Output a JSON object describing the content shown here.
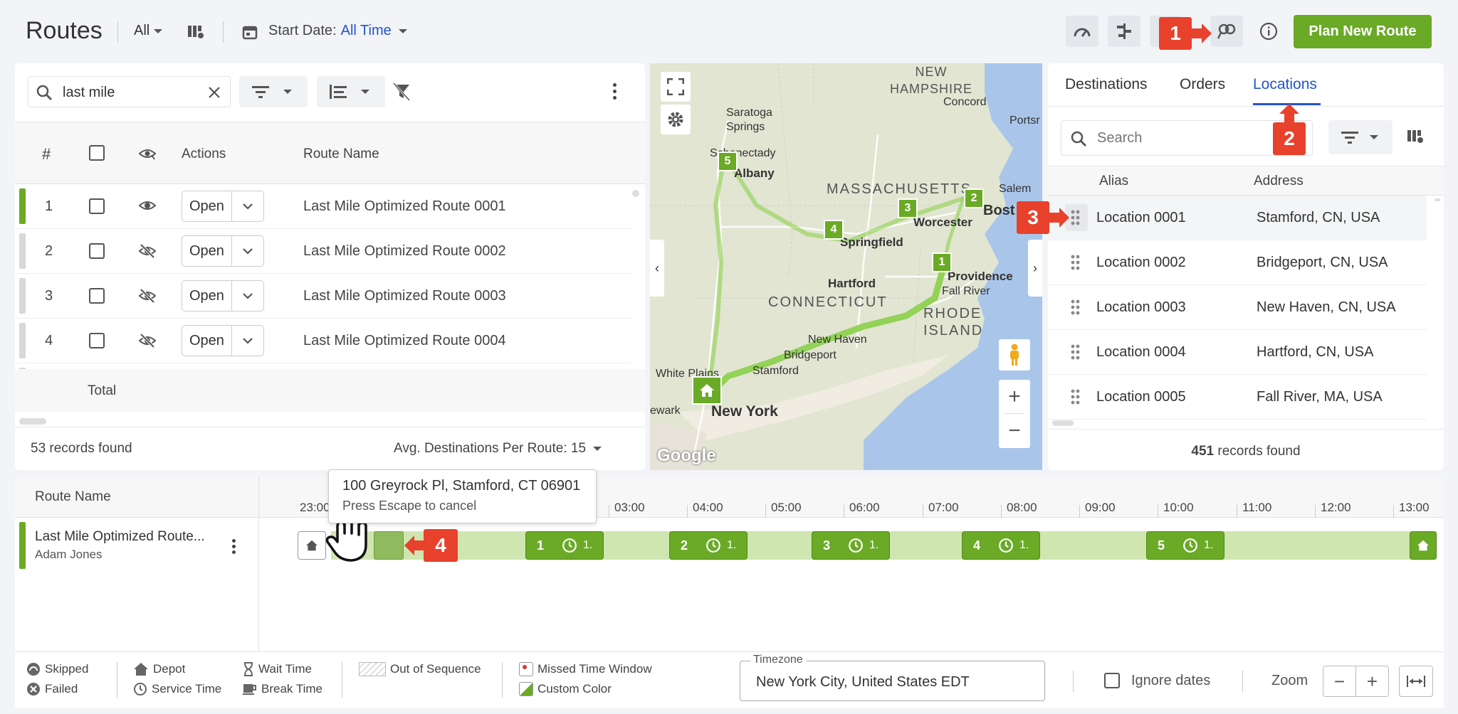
{
  "header": {
    "title": "Routes",
    "filter_all": "All",
    "start_date_label": "Start Date:",
    "start_date_value": "All Time",
    "plan_button": "Plan New Route"
  },
  "routes_panel": {
    "search_value": "last mile",
    "columns": {
      "num": "#",
      "actions": "Actions",
      "route_name": "Route Name"
    },
    "rows": [
      {
        "num": "1",
        "open": "Open",
        "name": "Last Mile Optimized Route 0001",
        "visible": true,
        "bar_color": "#6aaa26"
      },
      {
        "num": "2",
        "open": "Open",
        "name": "Last Mile Optimized Route 0002",
        "visible": false,
        "bar_color": "#d8d8d8"
      },
      {
        "num": "3",
        "open": "Open",
        "name": "Last Mile Optimized Route 0003",
        "visible": false,
        "bar_color": "#d8d8d8"
      },
      {
        "num": "4",
        "open": "Open",
        "name": "Last Mile Optimized Route 0004",
        "visible": false,
        "bar_color": "#d8d8d8"
      }
    ],
    "total_label": "Total",
    "records_found": "53 records found",
    "avg_label": "Avg. Destinations Per Route: 15"
  },
  "map": {
    "labels": {
      "new_hampshire": "NEW HAMPSHIRE",
      "concord": "Concord",
      "saratoga": "Saratoga Springs",
      "schenectady": "Schenectady",
      "albany": "Albany",
      "massachusetts": "MASSACHUSETTS",
      "salem": "Salem",
      "boston": "Bost",
      "worcester": "Worcester",
      "springfield": "Springfield",
      "hartford": "Hartford",
      "providence": "Providence",
      "connecticut": "CONNECTICUT",
      "rhode_island": "RHODE ISLAND",
      "fall_river": "Fall River",
      "new_haven": "New Haven",
      "bridgeport": "Bridgeport",
      "stamford": "Stamford",
      "white_plains": "White Plains",
      "newark": "ewark",
      "new_york": "New York",
      "portsmouth": "Portsr",
      "google": "Google"
    },
    "markers": [
      "1",
      "2",
      "3",
      "4",
      "5"
    ]
  },
  "locations_panel": {
    "tabs": [
      "Destinations",
      "Orders",
      "Locations"
    ],
    "active_tab": "Locations",
    "search_placeholder": "Search",
    "columns": {
      "alias": "Alias",
      "address": "Address"
    },
    "rows": [
      {
        "alias": "Location 0001",
        "address": "Stamford, CN, USA"
      },
      {
        "alias": "Location 0002",
        "address": "Bridgeport, CN, USA"
      },
      {
        "alias": "Location 0003",
        "address": "New Haven, CN, USA"
      },
      {
        "alias": "Location 0004",
        "address": "Hartford, CN, USA"
      },
      {
        "alias": "Location 0005",
        "address": "Fall River, MA, USA"
      }
    ],
    "records_count": "451",
    "records_suffix": " records found"
  },
  "timeline": {
    "route_name_header": "Route Name",
    "route_name": "Last Mile Optimized Route...",
    "driver": "Adam Jones",
    "hours": [
      "23:00",
      "03:00",
      "04:00",
      "05:00",
      "06:00",
      "07:00",
      "08:00",
      "09:00",
      "10:00",
      "11:00",
      "12:00",
      "13:00"
    ],
    "stops": [
      {
        "num": "1",
        "dur": "1."
      },
      {
        "num": "2",
        "dur": "1."
      },
      {
        "num": "3",
        "dur": "1."
      },
      {
        "num": "4",
        "dur": "1."
      },
      {
        "num": "5",
        "dur": "1."
      }
    ],
    "tooltip_address": "100 Greyrock Pl, Stamford, CT 06901",
    "tooltip_hint": "Press Escape to cancel"
  },
  "legend": {
    "skipped": "Skipped",
    "failed": "Failed",
    "depot": "Depot",
    "service_time": "Service Time",
    "wait_time": "Wait Time",
    "break_time": "Break Time",
    "out_of_sequence": "Out of Sequence",
    "missed_time_window": "Missed Time Window",
    "custom_color": "Custom Color",
    "timezone_label": "Timezone",
    "timezone_value": "New York City, United States EDT",
    "ignore_dates": "Ignore dates",
    "zoom": "Zoom"
  },
  "callouts": [
    "1",
    "2",
    "3",
    "4"
  ],
  "colors": {
    "accent_green": "#6aaa26",
    "brand_blue": "#2554c7",
    "callout_red": "#e8412c"
  }
}
